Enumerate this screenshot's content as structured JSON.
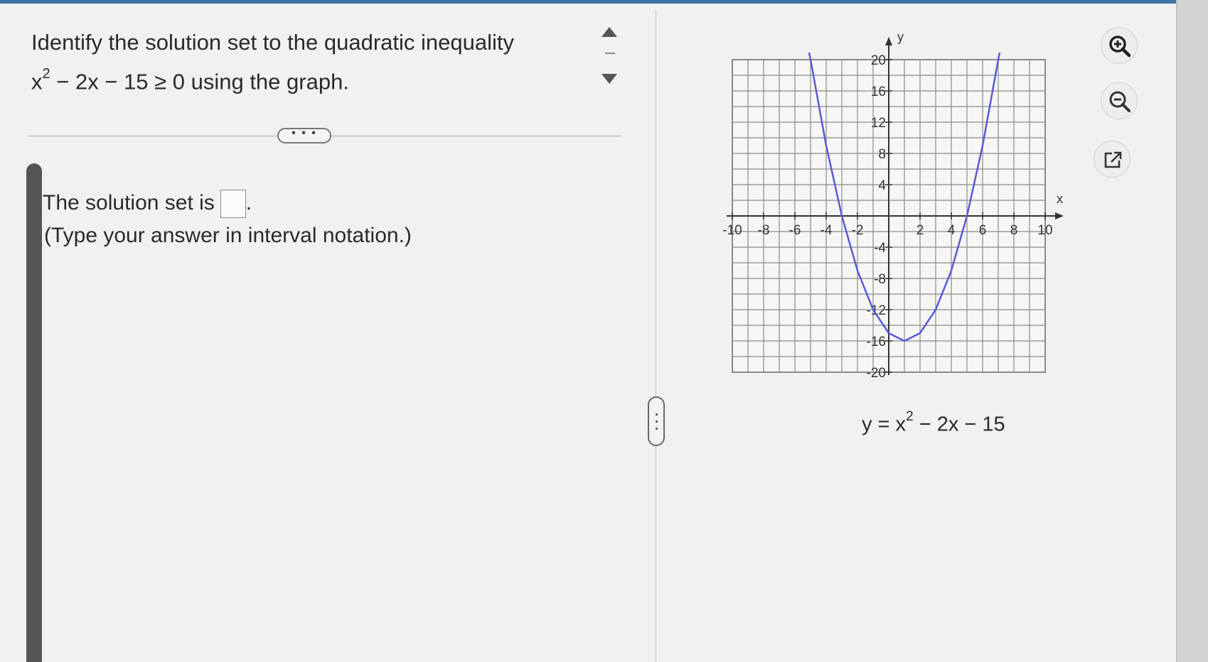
{
  "question": {
    "line1": "Identify the solution set to the quadratic inequality",
    "line2_pre": "x",
    "line2_exp": "2",
    "line2_post": " − 2x − 15 ≥ 0 using the graph."
  },
  "more_button": {
    "label": "• • •"
  },
  "answer": {
    "prefix": "The solution set is",
    "suffix": ".",
    "hint": "(Type your answer in interval notation.)",
    "value": ""
  },
  "graph_caption": {
    "pre": "y = x",
    "exp": "2",
    "post": " − 2x − 15"
  },
  "icons": {
    "zoom_in": "zoom-in-icon",
    "zoom_out": "zoom-out-icon",
    "open_new": "open-new-window-icon"
  },
  "colors": {
    "curve": "#5a5ad6",
    "grid": "#8a8a8a",
    "accent": "#3f74a6"
  },
  "chart_data": {
    "type": "line",
    "xlabel": "x",
    "ylabel": "y",
    "xlim": [
      -10,
      10
    ],
    "ylim": [
      -20,
      20
    ],
    "grid": true,
    "x_ticks": [
      "-10",
      "-8",
      "-6",
      "-4",
      "-2",
      "2",
      "4",
      "6",
      "8",
      "10"
    ],
    "y_ticks": [
      "20",
      "16",
      "12",
      "8",
      "4",
      "-4",
      "-8",
      "-12",
      "-16",
      "-20"
    ],
    "series": [
      {
        "x": [
          -5.4,
          -5,
          -4,
          -3,
          -2,
          -1,
          0,
          1,
          2,
          3,
          4,
          5,
          6,
          7,
          7.4
        ],
        "y": [
          24,
          20,
          9,
          0,
          -7,
          -12,
          -15,
          -16,
          -15,
          -12,
          -7,
          0,
          9,
          20,
          24
        ]
      }
    ]
  }
}
